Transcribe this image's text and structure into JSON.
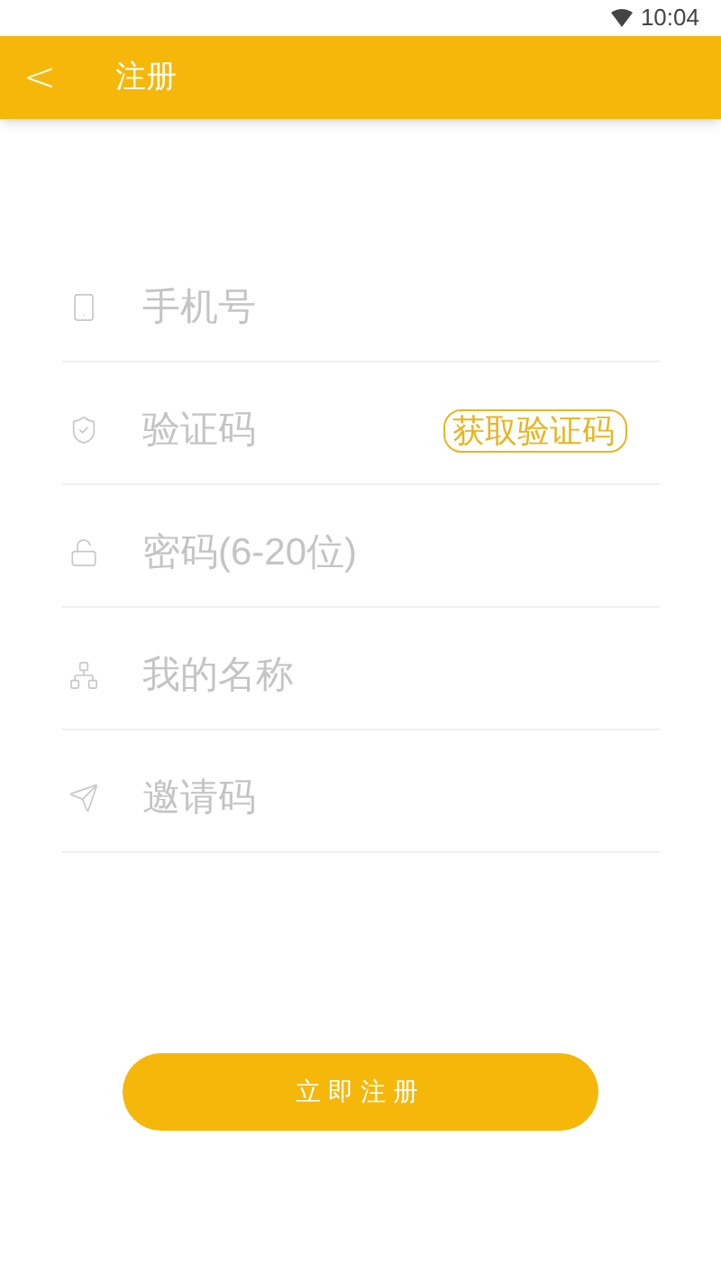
{
  "status_bar": {
    "time": "10:04"
  },
  "header": {
    "back": "<",
    "title": "注册"
  },
  "fields": [
    {
      "kind": "phone",
      "placeholder": "手机号"
    },
    {
      "kind": "code",
      "placeholder": "验证码",
      "action": "获取验证码"
    },
    {
      "kind": "password",
      "placeholder": "密码(6-20位)"
    },
    {
      "kind": "name",
      "placeholder": "我的名称"
    },
    {
      "kind": "invite",
      "placeholder": "邀请码"
    }
  ],
  "submit": "立即注册"
}
